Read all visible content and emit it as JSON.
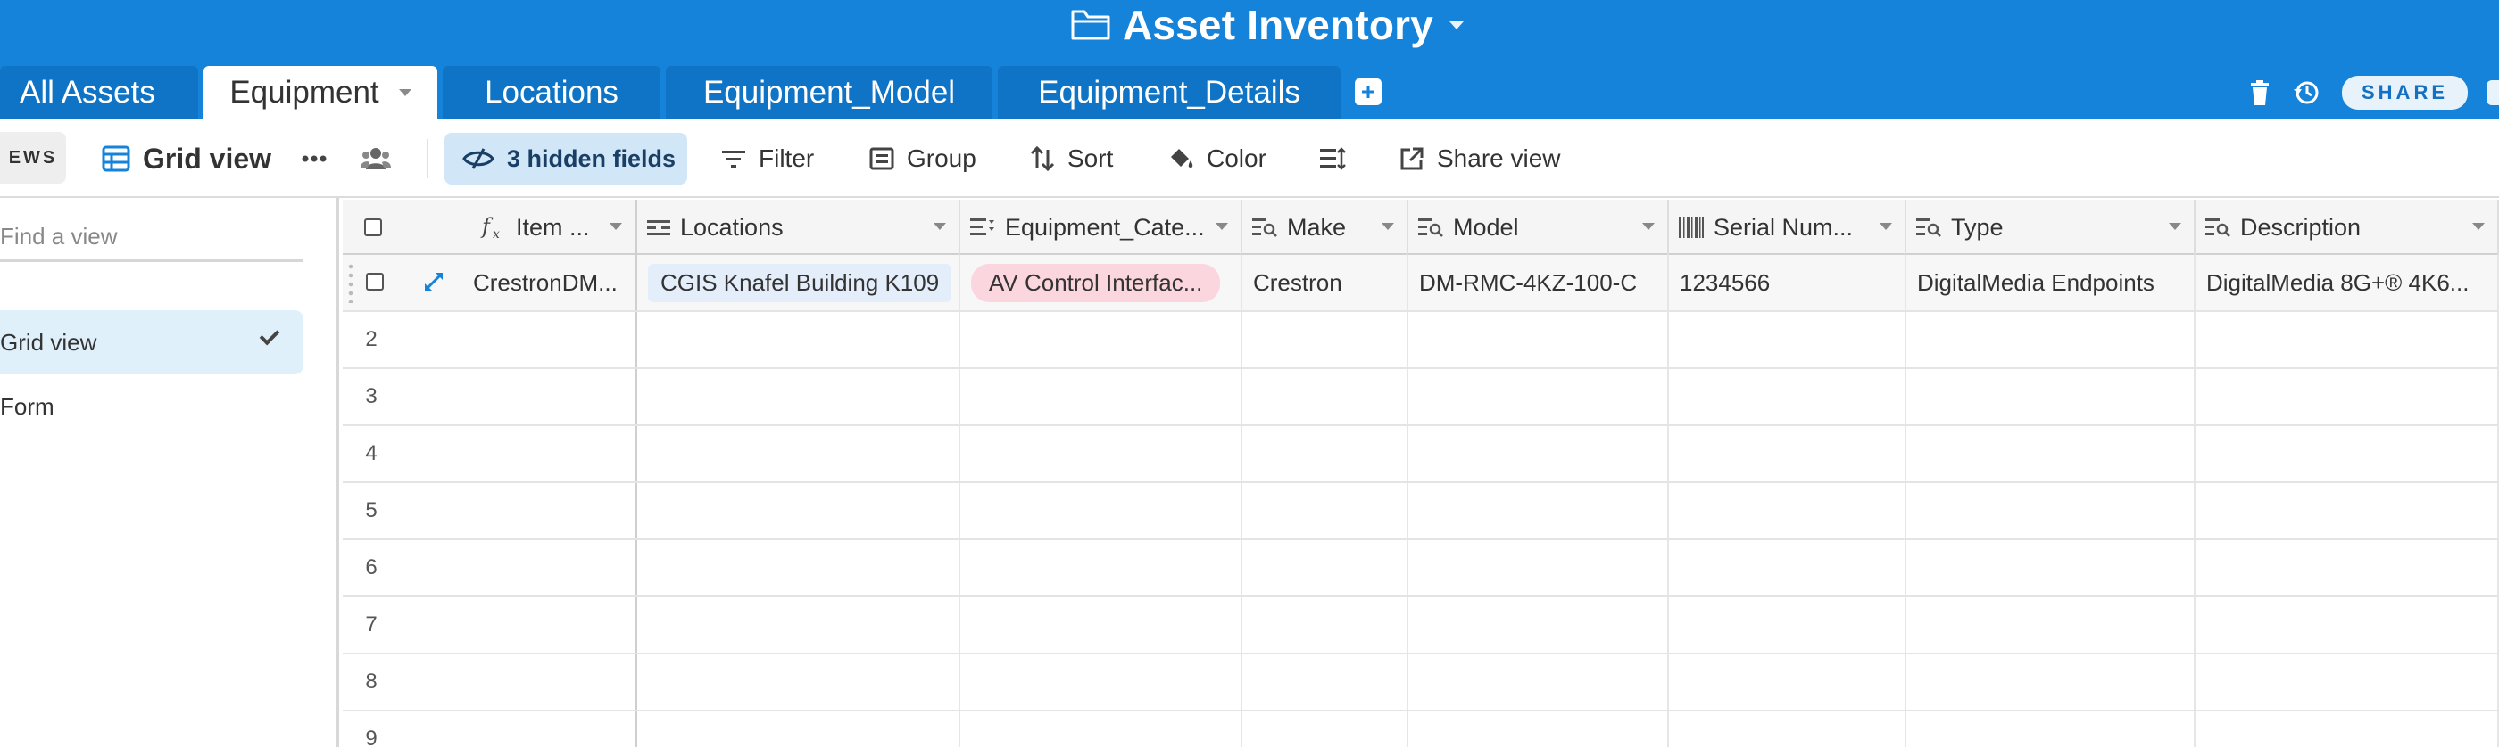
{
  "app": {
    "base_title": "Asset Inventory",
    "share_label": "SHARE",
    "tabs": [
      {
        "label": "All Assets",
        "active": false
      },
      {
        "label": "Equipment",
        "active": true
      },
      {
        "label": "Locations",
        "active": false
      },
      {
        "label": "Equipment_Model",
        "active": false
      },
      {
        "label": "Equipment_Details",
        "active": false
      }
    ]
  },
  "toolbar": {
    "views_label": "EWS",
    "view_name": "Grid view",
    "hidden_fields": "3 hidden fields",
    "filter": "Filter",
    "group": "Group",
    "sort": "Sort",
    "color": "Color",
    "share_view": "Share view"
  },
  "sidebar": {
    "find_placeholder": "Find a view",
    "views": [
      {
        "label": "Grid view",
        "selected": true
      },
      {
        "label": "Form",
        "selected": false
      }
    ]
  },
  "grid": {
    "columns": [
      {
        "label": "Item ...",
        "icon": "formula-icon"
      },
      {
        "label": "Locations",
        "icon": "link-icon"
      },
      {
        "label": "Equipment_Cate...",
        "icon": "lookup-icon"
      },
      {
        "label": "Make",
        "icon": "lookup-icon"
      },
      {
        "label": "Model",
        "icon": "lookup-icon"
      },
      {
        "label": "Serial Num...",
        "icon": "barcode-icon"
      },
      {
        "label": "Type",
        "icon": "lookup-icon"
      },
      {
        "label": "Description",
        "icon": "lookup-icon"
      }
    ],
    "rows": [
      {
        "item": "CrestronDM...",
        "location": "CGIS Knafel Building K109",
        "category": "AV Control Interfac...",
        "make": "Crestron",
        "model": "DM-RMC-4KZ-100-C",
        "serial": "1234566",
        "type": "DigitalMedia Endpoints",
        "description": "DigitalMedia 8G+® 4K6..."
      }
    ],
    "empty_row_numbers": [
      "2",
      "3",
      "4",
      "5",
      "6",
      "7",
      "8",
      "9"
    ]
  },
  "colors": {
    "top_bar": "#1583d9",
    "accent": "#1370c2",
    "category_pill": "#fcd6de",
    "location_pill": "#e4eefb"
  }
}
